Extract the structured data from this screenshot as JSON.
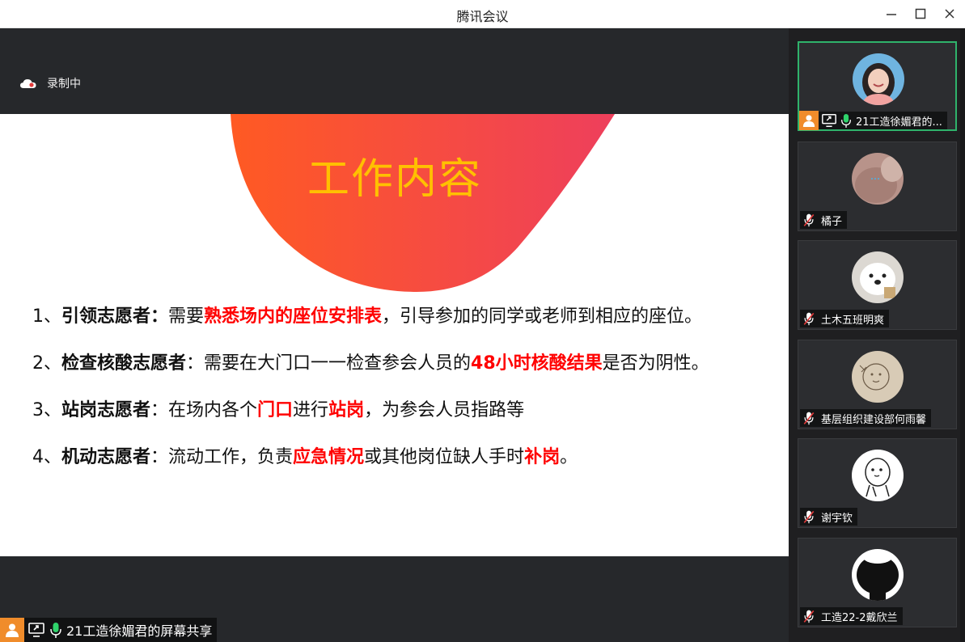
{
  "window": {
    "title": "腾讯会议"
  },
  "recording": {
    "label": "录制中"
  },
  "slide": {
    "title": "工作内容",
    "items": [
      {
        "num": "1、",
        "role": "引领志愿者：",
        "p1": "需要",
        "h1": "熟悉场内的座位安排表",
        "p2": "，引导参加的同学或老师到相应的座位。",
        "h2": "",
        "p3": ""
      },
      {
        "num": "2、",
        "role": "检查核酸志愿者",
        "p1": "：需要在大门口一一检查参会人员的",
        "h1": "48小时核酸结果",
        "p2": "是否为阴性。",
        "h2": "",
        "p3": ""
      },
      {
        "num": "3、",
        "role": "站岗志愿者",
        "p1": "：在场内各个",
        "h1": "门口",
        "p2": "进行",
        "h2": "站岗",
        "p3": "，为参会人员指路等"
      },
      {
        "num": "4、",
        "role": "机动志愿者",
        "p1": "：流动工作，负责",
        "h1": "应急情况",
        "p2": "或其他岗位缺人手时",
        "h2": "补岗",
        "p3": "。"
      }
    ]
  },
  "screen_share": {
    "label": "21工造徐媚君的屏幕共享"
  },
  "participants": [
    {
      "name": "21工造徐媚君的...",
      "active": true,
      "muted": false
    },
    {
      "name": "橘子",
      "active": false,
      "muted": true
    },
    {
      "name": "土木五班明爽",
      "active": false,
      "muted": true
    },
    {
      "name": "基层组织建设部何雨馨",
      "active": false,
      "muted": true
    },
    {
      "name": "谢宇钦",
      "active": false,
      "muted": true
    },
    {
      "name": "工造22-2戴欣兰",
      "active": false,
      "muted": true
    }
  ]
}
